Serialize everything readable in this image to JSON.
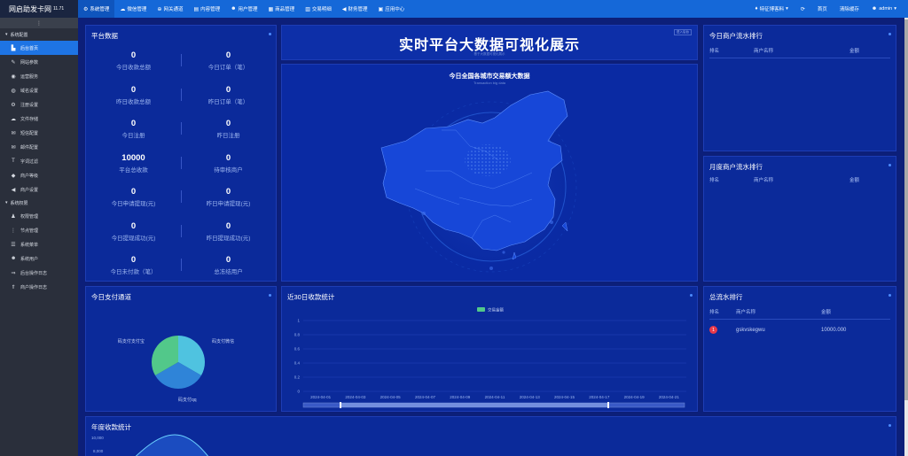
{
  "app": {
    "logo": "网启助发卡网",
    "version": "11.71"
  },
  "topnav": [
    {
      "label": "系统管理",
      "icon": "gear-icon",
      "glyph": "⚙",
      "active": true
    },
    {
      "label": "微信管理",
      "icon": "wechat-icon",
      "glyph": "☁",
      "active": false
    },
    {
      "label": "网关通道",
      "icon": "gateway-icon",
      "glyph": "⊕",
      "active": false
    },
    {
      "label": "内容管理",
      "icon": "content-icon",
      "glyph": "▤",
      "active": false
    },
    {
      "label": "用户管理",
      "icon": "users-icon",
      "glyph": "☻",
      "active": false
    },
    {
      "label": "商品管理",
      "icon": "goods-icon",
      "glyph": "▦",
      "active": false
    },
    {
      "label": "交易明细",
      "icon": "chart-icon",
      "glyph": "▥",
      "active": false
    },
    {
      "label": "财务管理",
      "icon": "finance-icon",
      "glyph": "◀",
      "active": false
    },
    {
      "label": "应用中心",
      "icon": "apps-icon",
      "glyph": "▣",
      "active": false
    }
  ],
  "topright": {
    "notice": "特征博客料",
    "refresh_glyph": "⟳",
    "home": "首页",
    "clear_cache": "清除缓存",
    "user": "admin"
  },
  "sidebar": {
    "groups": [
      {
        "label": "系统配置",
        "items": [
          {
            "label": "后台首页",
            "glyph": "▙",
            "icon": "dashboard-icon",
            "active": true
          },
          {
            "label": "网站参数",
            "glyph": "✎",
            "icon": "site-params-icon",
            "active": false
          },
          {
            "label": "运营服务",
            "glyph": "◉",
            "icon": "operation-icon",
            "active": false
          },
          {
            "label": "域名设置",
            "glyph": "◍",
            "icon": "domain-icon",
            "active": false
          },
          {
            "label": "注册设置",
            "glyph": "⚙",
            "icon": "register-settings-icon",
            "active": false
          },
          {
            "label": "文件存储",
            "glyph": "☁",
            "icon": "storage-icon",
            "active": false
          },
          {
            "label": "短信配置",
            "glyph": "✉",
            "icon": "sms-icon",
            "active": false
          },
          {
            "label": "邮件配置",
            "glyph": "✉",
            "icon": "mail-icon",
            "active": false
          },
          {
            "label": "字词过滤",
            "glyph": "T",
            "icon": "filter-icon",
            "active": false
          },
          {
            "label": "商户等级",
            "glyph": "◆",
            "icon": "level-icon",
            "active": false
          },
          {
            "label": "商户设置",
            "glyph": "◀",
            "icon": "merchant-settings-icon",
            "active": false
          }
        ]
      },
      {
        "label": "系统权限",
        "items": [
          {
            "label": "权限管理",
            "glyph": "♟",
            "icon": "permission-icon",
            "active": false
          },
          {
            "label": "节点管理",
            "glyph": "⋮",
            "icon": "node-icon",
            "active": false
          },
          {
            "label": "系统菜单",
            "glyph": "☰",
            "icon": "menu-icon",
            "active": false
          },
          {
            "label": "系统用户",
            "glyph": "☻",
            "icon": "system-users-icon",
            "active": false
          },
          {
            "label": "后台操作日志",
            "glyph": "⇒",
            "icon": "admin-log-icon",
            "active": false
          },
          {
            "label": "商户操作日志",
            "glyph": "⇑",
            "icon": "merchant-log-icon",
            "active": false
          }
        ]
      }
    ]
  },
  "platform": {
    "title": "平台数据",
    "stats": [
      {
        "value": "0",
        "label": "今日收款总额"
      },
      {
        "value": "0",
        "label": "今日订单（笔）"
      },
      {
        "value": "0",
        "label": "昨日收款总额"
      },
      {
        "value": "0",
        "label": "昨日订单（笔）"
      },
      {
        "value": "0",
        "label": "今日注册"
      },
      {
        "value": "0",
        "label": "昨日注册"
      },
      {
        "value": "10000",
        "label": "平台总收款"
      },
      {
        "value": "0",
        "label": "待审核商户"
      },
      {
        "value": "0",
        "label": "今日申请提现(元)"
      },
      {
        "value": "0",
        "label": "昨日申请提现(元)"
      },
      {
        "value": "0",
        "label": "今日提现成功(元)"
      },
      {
        "value": "0",
        "label": "昨日提现成功(元)"
      },
      {
        "value": "0",
        "label": "今日未付款（笔）"
      },
      {
        "value": "0",
        "label": "总冻结用户"
      }
    ]
  },
  "banner": {
    "title": "实时平台大数据可视化展示",
    "subtitle": "基于大数据可视化展示",
    "corner": "进入后台"
  },
  "map": {
    "title": "今日全国各城市交易额大数据",
    "subtitle": "Transaction big data"
  },
  "today_rank": {
    "title": "今日商户流水排行",
    "headers": [
      "排名",
      "商户名称",
      "金额"
    ]
  },
  "month_rank": {
    "title": "月度商户流水排行",
    "headers": [
      "排名",
      "商户名称",
      "金额"
    ]
  },
  "total_rank": {
    "title": "总流水排行",
    "headers": [
      "排名",
      "商户名称",
      "金额"
    ],
    "rows": [
      {
        "rank": "1",
        "name": "gskvskegwu",
        "amount": "10000.000"
      }
    ]
  },
  "channels": {
    "title": "今日支付通道",
    "chart_data": {
      "type": "pie",
      "labels": [
        "码支付微信",
        "码支付qq",
        "码支付支付宝"
      ],
      "values": [
        1,
        1,
        1
      ],
      "colors": [
        "#4fc3e0",
        "#2f84d8",
        "#52c88a"
      ]
    }
  },
  "thirty_days": {
    "title": "近30日收款统计",
    "chart_data": {
      "type": "bar",
      "series": [
        {
          "name": "交易金额",
          "values": [
            0,
            0,
            0,
            0,
            0,
            0,
            0,
            0,
            0,
            0,
            0
          ]
        }
      ],
      "categories": [
        "2024-04-01",
        "2024-04-03",
        "2024-04-05",
        "2024-04-07",
        "2024-04-09",
        "2024-04-11",
        "2024-04-13",
        "2024-04-15",
        "2024-04-17",
        "2024-04-19",
        "2024-04-21"
      ],
      "yticks": [
        "0",
        "0.2",
        "0.4",
        "0.6",
        "0.8",
        "1"
      ],
      "ylim": [
        0,
        1
      ],
      "legend_color": "#52c88a"
    }
  },
  "yearly": {
    "title": "年度收款统计",
    "chart_data": {
      "type": "area",
      "yticks": [
        "10,000",
        "8,000"
      ]
    }
  }
}
